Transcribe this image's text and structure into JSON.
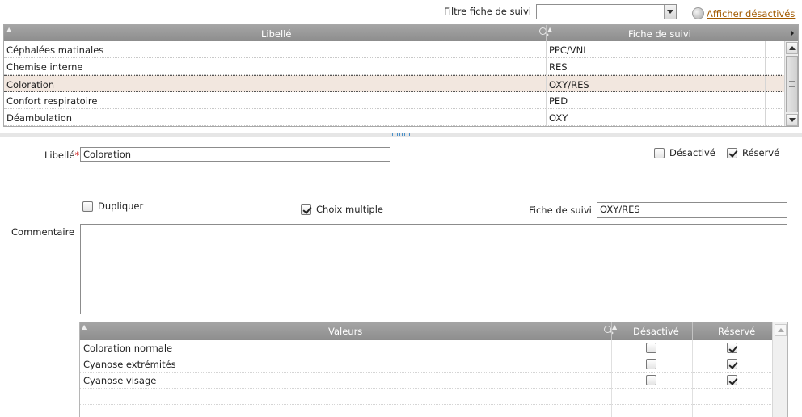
{
  "filter": {
    "label": "Filtre fiche de suivi",
    "value": "",
    "show_disabled_link": "Afficher désactivés"
  },
  "grid": {
    "columns": [
      "Libellé",
      "Fiche de suivi"
    ],
    "rows": [
      {
        "libelle": "Céphalées matinales",
        "fiche": "PPC/VNI"
      },
      {
        "libelle": "Chemise interne",
        "fiche": "RES"
      },
      {
        "libelle": "Coloration",
        "fiche": "OXY/RES"
      },
      {
        "libelle": "Confort respiratoire",
        "fiche": "PED"
      },
      {
        "libelle": "Déambulation",
        "fiche": "OXY"
      }
    ],
    "selected_row": "Coloration"
  },
  "form": {
    "libelle_label": "Libellé",
    "required_mark": "*",
    "libelle_value": "Coloration",
    "desactive_label": "Désactivé",
    "desactive_checked": false,
    "reserve_label": "Réservé",
    "reserve_checked": true,
    "dupliquer_label": "Dupliquer",
    "dupliquer_checked": false,
    "choix_multiple_label": "Choix multiple",
    "choix_multiple_checked": true,
    "fiche_label": "Fiche de suivi",
    "fiche_value": "OXY/RES",
    "commentaire_label": "Commentaire",
    "commentaire_value": ""
  },
  "valeurs": {
    "columns": [
      "Valeurs",
      "Désactivé",
      "Réservé"
    ],
    "rows": [
      {
        "label": "Coloration normale",
        "desactive": false,
        "reserve": true
      },
      {
        "label": "Cyanose extrémités",
        "desactive": false,
        "reserve": true
      },
      {
        "label": "Cyanose visage",
        "desactive": false,
        "reserve": true
      }
    ]
  }
}
